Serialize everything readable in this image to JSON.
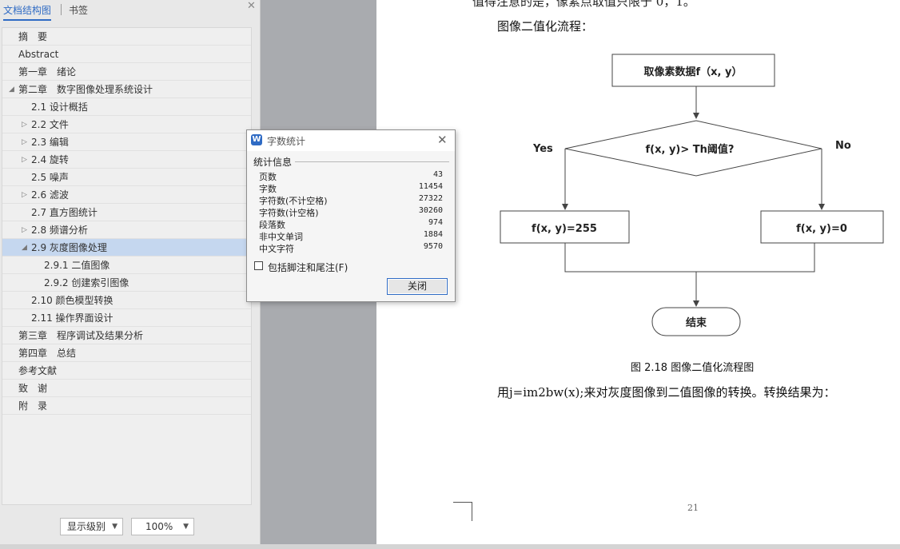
{
  "nav": {
    "tabs": [
      "文档结构图",
      "书签"
    ],
    "close_glyph": "✕",
    "outline": [
      {
        "label": "摘　要",
        "level": 0,
        "arrow": ""
      },
      {
        "label": "Abstract",
        "level": 0,
        "arrow": ""
      },
      {
        "label": "第一章　绪论",
        "level": 0,
        "arrow": ""
      },
      {
        "label": "第二章　数字图像处理系统设计",
        "level": 0,
        "arrow": "◢"
      },
      {
        "label": "2.1 设计概括",
        "level": 1,
        "arrow": ""
      },
      {
        "label": "2.2 文件",
        "level": 1,
        "arrow": "▷"
      },
      {
        "label": "2.3 编辑",
        "level": 1,
        "arrow": "▷"
      },
      {
        "label": "2.4 旋转",
        "level": 1,
        "arrow": "▷"
      },
      {
        "label": "2.5 噪声",
        "level": 1,
        "arrow": ""
      },
      {
        "label": "2.6 滤波",
        "level": 1,
        "arrow": "▷"
      },
      {
        "label": "2.7 直方图统计",
        "level": 1,
        "arrow": ""
      },
      {
        "label": "2.8 频谱分析",
        "level": 1,
        "arrow": "▷"
      },
      {
        "label": "2.9 灰度图像处理",
        "level": 1,
        "arrow": "◢",
        "selected": true
      },
      {
        "label": "2.9.1 二值图像",
        "level": 2,
        "arrow": ""
      },
      {
        "label": "2.9.2 创建索引图像",
        "level": 2,
        "arrow": ""
      },
      {
        "label": "2.10 颜色模型转换",
        "level": 1,
        "arrow": ""
      },
      {
        "label": "2.11 操作界面设计",
        "level": 1,
        "arrow": ""
      },
      {
        "label": "第三章　程序调试及结果分析",
        "level": 0,
        "arrow": ""
      },
      {
        "label": "第四章　总结",
        "level": 0,
        "arrow": ""
      },
      {
        "label": "参考文献",
        "level": 0,
        "arrow": ""
      },
      {
        "label": "致　谢",
        "level": 0,
        "arrow": ""
      },
      {
        "label": "附　录",
        "level": 0,
        "arrow": ""
      }
    ],
    "level_select": "显示级别",
    "zoom_select": "100%",
    "dropdown_glyph": "▼"
  },
  "document": {
    "top_line": "值得注意的是，像素点取值只限于 0，1。",
    "flow_intro": "图像二值化流程：",
    "flowchart": {
      "start": "取像素数据f（x, y）",
      "decision": "f(x, y)> Th阈值?",
      "yes": "Yes",
      "no": "No",
      "left_box": "f(x, y)=255",
      "right_box": "f(x, y)=0",
      "end": "结束"
    },
    "caption": "图 2.18  图像二值化流程图",
    "result_line": "用j=im2bw(x);来对灰度图像到二值图像的转换。转换结果为：",
    "page_number": "21"
  },
  "dialog": {
    "icon_glyph": "W",
    "title": "字数统计",
    "close_glyph": "✕",
    "group_label": "统计信息",
    "stats": [
      {
        "label": "页数",
        "value": "43"
      },
      {
        "label": "字数",
        "value": "11454"
      },
      {
        "label": "字符数(不计空格)",
        "value": "27322"
      },
      {
        "label": "字符数(计空格)",
        "value": "30260"
      },
      {
        "label": "段落数",
        "value": "974"
      },
      {
        "label": "非中文单词",
        "value": "1884"
      },
      {
        "label": "中文字符",
        "value": "9570"
      }
    ],
    "checkbox_label": "包括脚注和尾注(F)",
    "checkbox_checked": false,
    "close_button": "关闭"
  },
  "colors": {
    "accent": "#2f6bc4",
    "selected_row": "#c5d7ef",
    "nav_bg": "#e8e8e8",
    "workspace_bg": "#a9abaf"
  }
}
